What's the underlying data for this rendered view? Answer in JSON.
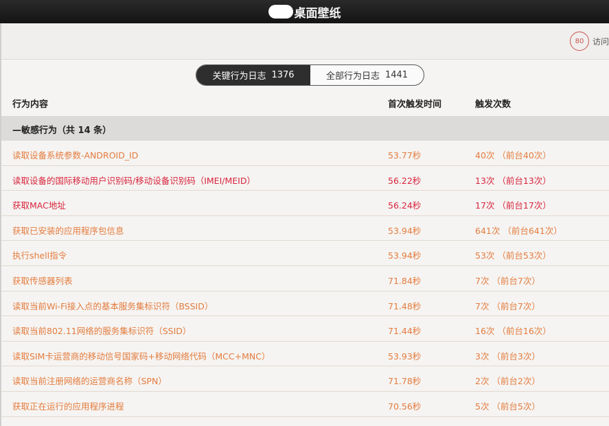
{
  "window": {
    "title": "桌面壁纸"
  },
  "header": {
    "visit_count": "80",
    "visit_label": "访问"
  },
  "tabs": [
    {
      "label": "关键行为日志",
      "count": "1376"
    },
    {
      "label": "全部行为日志",
      "count": "1441"
    }
  ],
  "columns": {
    "content": "行为内容",
    "first_time": "首次触发时间",
    "count": "触发次数"
  },
  "section": {
    "title": "—敏感行为（共",
    "count": "14",
    "suffix": "条）"
  },
  "rows": [
    {
      "content": "读取设备系统参数-ANDROID_ID",
      "time": "53.77秒",
      "count": "40次 （前台40次）"
    },
    {
      "content": "读取设备的国际移动用户识别码/移动设备识别码（IMEI/MEID）",
      "time": "56.22秒",
      "count": "13次 （前台13次）"
    },
    {
      "content": "获取MAC地址",
      "time": "56.24秒",
      "count": "17次 （前台17次）"
    },
    {
      "content": "获取已安装的应用程序包信息",
      "time": "53.94秒",
      "count": "641次 （前台641次）"
    },
    {
      "content": "执行shell指令",
      "time": "53.94秒",
      "count": "53次 （前台53次）"
    },
    {
      "content": "获取传感器列表",
      "time": "71.84秒",
      "count": "7次 （前台7次）"
    },
    {
      "content": "读取当前Wi-Fi接入点的基本服务集标识符（BSSID）",
      "time": "71.48秒",
      "count": "7次 （前台7次）"
    },
    {
      "content": "读取当前802.11网络的服务集标识符（SSID）",
      "time": "71.44秒",
      "count": "16次 （前台16次）"
    },
    {
      "content": "读取SIM卡运营商的移动信号国家码+移动网络代码（MCC+MNC）",
      "time": "53.93秒",
      "count": "3次 （前台3次）"
    },
    {
      "content": "读取当前注册网络的运营商名称（SPN）",
      "time": "71.78秒",
      "count": "2次 （前台2次）"
    },
    {
      "content": "获取正在运行的应用程序进程",
      "time": "70.56秒",
      "count": "5次 （前台5次）"
    }
  ],
  "colors": {
    "normal_row": "#e47b3d",
    "highlight_row": "#d8243c"
  }
}
